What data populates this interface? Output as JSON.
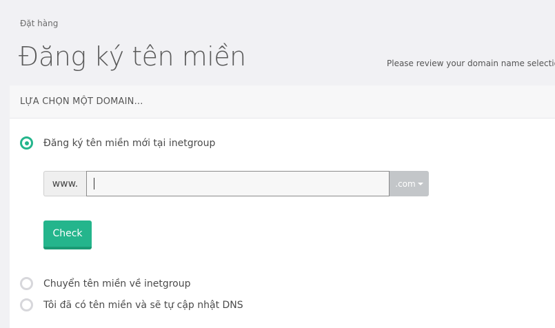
{
  "breadcrumb": {
    "current": "Đặt hàng"
  },
  "header": {
    "title": "Đăng ký tên miền",
    "subtitle": "Please review your domain name selections"
  },
  "panel": {
    "heading": "LỰA CHỌN MỘT DOMAIN...",
    "options": [
      {
        "label": "Đăng ký tên miền mới tại inetgroup",
        "checked": true
      },
      {
        "label": "Chuyển tên miền về inetgroup",
        "checked": false
      },
      {
        "label": "Tôi đã có tên miền và sẽ tự cập nhật DNS",
        "checked": false
      }
    ],
    "domain_prefix": "www.",
    "domain_value": "",
    "tld_selected": ".com",
    "check_label": "Check"
  },
  "colors": {
    "accent": "#24b58c",
    "background": "#f1f1f4"
  }
}
